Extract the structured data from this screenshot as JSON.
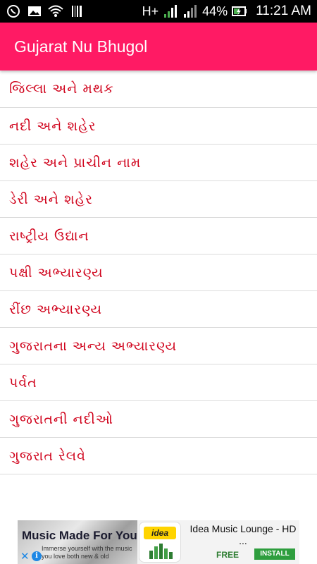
{
  "status_bar": {
    "network_type": "H+",
    "battery_percent": "44%",
    "time": "11:21 AM",
    "left_icons": [
      "whatsapp-icon",
      "image-icon",
      "wifi-icon",
      "barcode-icon"
    ],
    "right_icons": [
      "signal-1-icon",
      "signal-2-icon",
      "battery-charging-icon"
    ]
  },
  "toolbar": {
    "title": "Gujarat Nu Bhugol",
    "color": "#ff1a64"
  },
  "list": {
    "text_color": "#d0021b",
    "items": [
      {
        "label": "જિલ્લા અને મથક"
      },
      {
        "label": "નદી અને શહેર"
      },
      {
        "label": "શહેર અને પ્રાચીન નામ"
      },
      {
        "label": "ડેરી અને શહેર"
      },
      {
        "label": "રાષ્ટ્રીય ઉદ્યાન"
      },
      {
        "label": "પક્ષી અભ્યારણ્ય"
      },
      {
        "label": "રીંછ અભ્યારણ્ય"
      },
      {
        "label": "ગુજરાતના અન્ય અભ્યારણ્ય"
      },
      {
        "label": "પર્વત"
      },
      {
        "label": "ગુજરાતની નદીઓ"
      },
      {
        "label": "ગુજરાત રેલવે"
      }
    ]
  },
  "ad": {
    "headline": "Music Made For You",
    "subline": "Immerse yourself with the music you love both new & old",
    "logo_text": "idea",
    "app_title": "Idea Music Lounge - HD ...",
    "price": "FREE",
    "install_label": "INSTALL"
  }
}
